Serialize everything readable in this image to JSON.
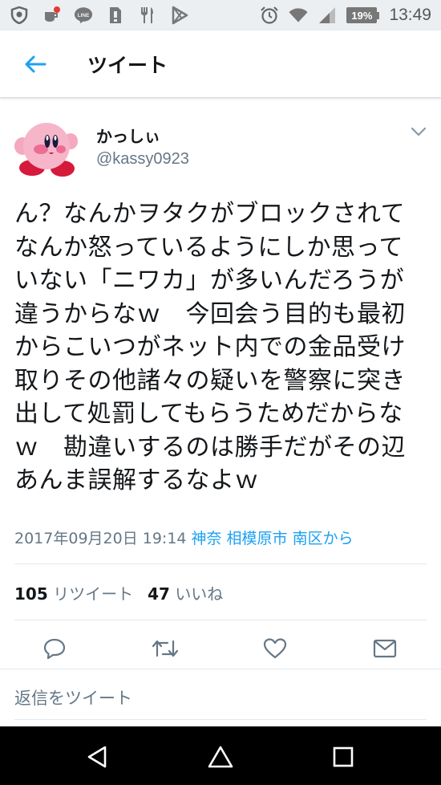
{
  "status_bar": {
    "time": "13:49",
    "battery": "19%",
    "icons": [
      "vpn-shield-icon",
      "notification-icon",
      "line-icon",
      "sim-icon",
      "restaurant-icon",
      "play-store-icon",
      "alarm-icon",
      "wifi-icon",
      "signal-icon",
      "battery-icon"
    ]
  },
  "header": {
    "title": "ツイート",
    "back_icon": "back-arrow-icon"
  },
  "tweet": {
    "author_name": "かっしぃ",
    "author_handle": "@kassy0923",
    "text": "ん？なんかヲタクがブロックされてなんか怒っているようにしか思っていない「ニワカ」が多いんだろうが違うからなｗ　今回会う目的も最初からこいつがネット内での金品受け取りその他諸々の疑いを警察に突き出して処罰してもらうためだからなｗ　勘違いするのは勝手だがその辺あんま誤解するなよｗ",
    "timestamp": "2017年09月20日 19:14",
    "location": "神奈 相模原市 南区から",
    "retweet_count": "105",
    "retweet_label": "リツイート",
    "like_count": "47",
    "like_label": "いいね"
  },
  "actions": [
    "reply-icon",
    "retweet-icon",
    "like-icon",
    "message-icon"
  ],
  "reply_placeholder": "返信をツイート",
  "colors": {
    "accent": "#1da1f2",
    "text": "#14171a",
    "secondary": "#657786",
    "status_bar_bg": "#eceff1",
    "nav_bar_bg": "#000000"
  }
}
